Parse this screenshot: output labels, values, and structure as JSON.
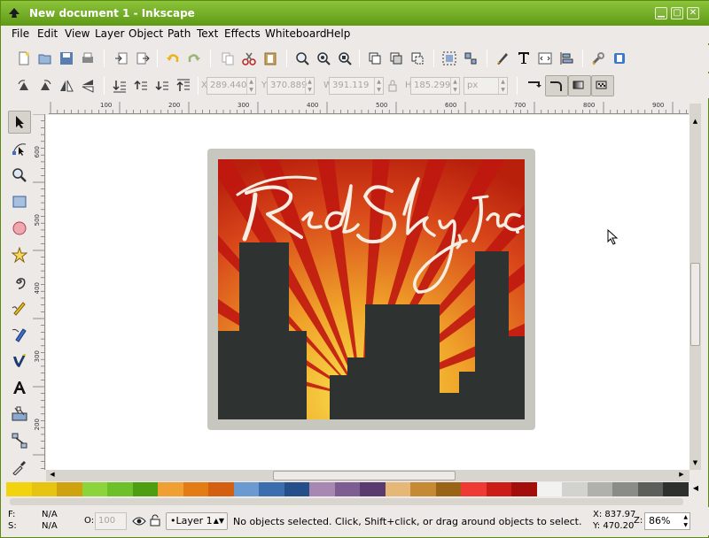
{
  "window": {
    "title": "New document 1 - Inkscape",
    "min_label": "▢",
    "max_label": "□",
    "close_label": "✕"
  },
  "menu": [
    "File",
    "Edit",
    "View",
    "Layer",
    "Object",
    "Path",
    "Text",
    "Effects",
    "Whiteboard",
    "Help"
  ],
  "menu_underline": [
    "F",
    "E",
    "V",
    "L",
    "O",
    "P",
    "T",
    "c",
    "W",
    "H"
  ],
  "toolbar_select": {
    "x": "289.440",
    "y": "370.889",
    "w": "391.119",
    "h": "185.299",
    "unit": "px",
    "x_label": "X",
    "y_label": "Y",
    "w_label": "W",
    "h_label": "H"
  },
  "ruler_h_labels": [
    "100",
    "200",
    "300",
    "400",
    "500",
    "600",
    "700",
    "800",
    "900"
  ],
  "ruler_v_labels": [
    "600",
    "500",
    "400",
    "300",
    "200"
  ],
  "logo": {
    "text": "Red Sky, Inc.",
    "bg_top": "#c8320d",
    "bg_bottom": "#f0a42a",
    "building_color": "#2e3230"
  },
  "palette": [
    "#f2d40e",
    "#e8c412",
    "#cfa20f",
    "#8bd43c",
    "#6cc02a",
    "#4e9e12",
    "#f0a032",
    "#e47c16",
    "#d45f10",
    "#6a9ad0",
    "#3a6eae",
    "#244f8a",
    "#a887b3",
    "#7d5d92",
    "#5a3b70",
    "#e6b878",
    "#c68a34",
    "#9a6416",
    "#ee3a32",
    "#cc1c16",
    "#a40e0a",
    "#f2f2f0",
    "#d2d2ce",
    "#b0b0ac",
    "#8a8c88",
    "#5c5e5a",
    "#2e302e"
  ],
  "status": {
    "fill_label": "F:",
    "stroke_label": "S:",
    "fill": "N/A",
    "stroke": "N/A",
    "opacity_label": "O:",
    "opacity": "100",
    "layer": "•Layer 1",
    "message": "No objects selected. Click, Shift+click, or drag around objects to select.",
    "coord_x": "X: 837.97",
    "coord_y": "Y: 470.20",
    "zoom_label": "Z:",
    "zoom": "86%"
  }
}
